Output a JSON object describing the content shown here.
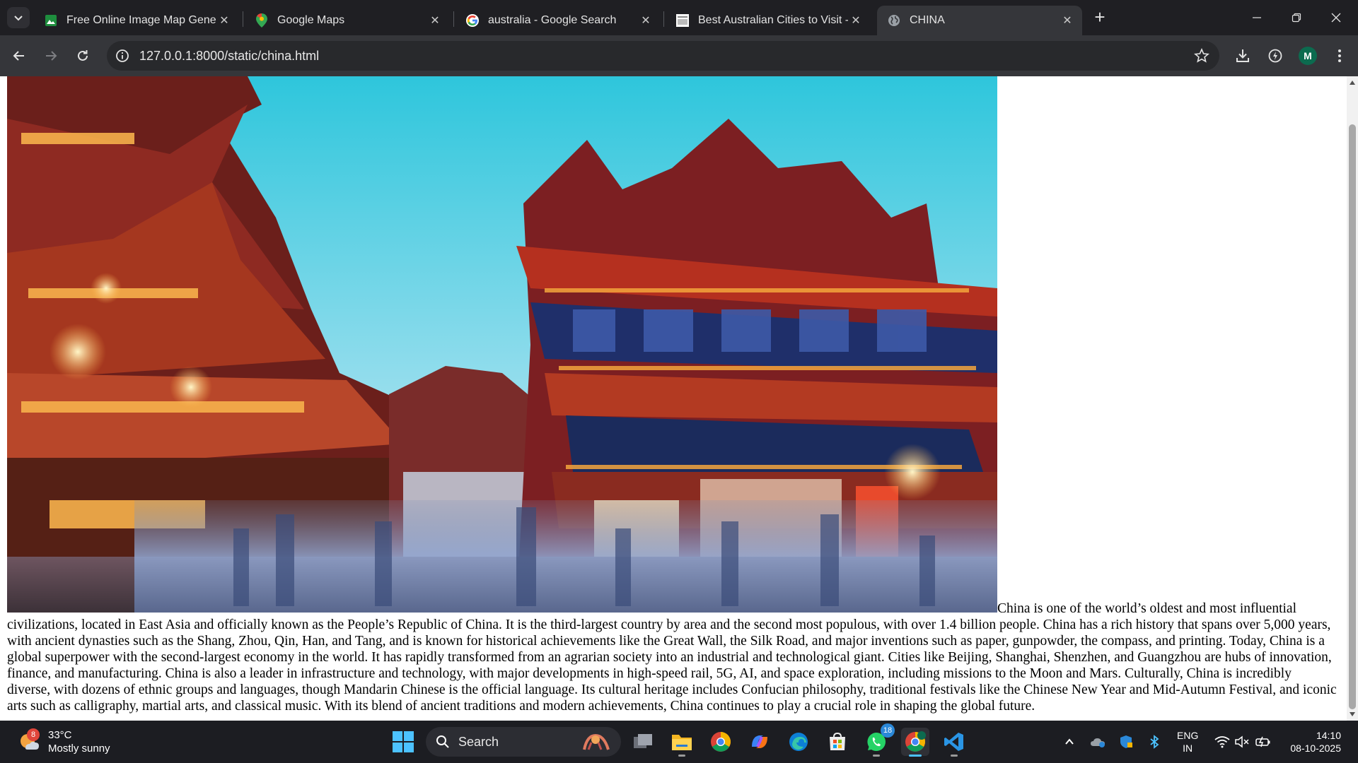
{
  "browser": {
    "tabs": [
      {
        "title": "Free Online Image Map Genera",
        "icon": "image-map-generator-favicon",
        "active": false
      },
      {
        "title": "Google Maps",
        "icon": "google-maps-favicon",
        "active": false
      },
      {
        "title": "australia - Google Search",
        "icon": "google-favicon",
        "active": false
      },
      {
        "title": "Best Australian Cities to Visit - E",
        "icon": "site-favicon",
        "active": false
      },
      {
        "title": "CHINA",
        "icon": "globe-favicon",
        "active": true
      }
    ],
    "close_glyph": "✕",
    "new_tab_glyph": "+",
    "url": "127.0.0.1:8000/static/china.html",
    "profile_initial": "M"
  },
  "page": {
    "image_alt": "",
    "paragraph": "China is one of the world’s oldest and most influential civilizations, located in East Asia and officially known as the People’s Republic of China. It is the third-largest country by area and the second most populous, with over 1.4 billion people. China has a rich history that spans over 5,000 years, with ancient dynasties such as the Shang, Zhou, Qin, Han, and Tang, and is known for historical achievements like the Great Wall, the Silk Road, and major inventions such as paper, gunpowder, the compass, and printing. Today, China is a global superpower with the second-largest economy in the world. It has rapidly transformed from an agrarian society into an industrial and technological giant. Cities like Beijing, Shanghai, Shenzhen, and Guangzhou are hubs of innovation, finance, and manufacturing. China is also a leader in infrastructure and technology, with major developments in high-speed rail, 5G, AI, and space exploration, including missions to the Moon and Mars. Culturally, China is incredibly diverse, with dozens of ethnic groups and languages, though Mandarin Chinese is the official language. Its cultural heritage includes Confucian philosophy, traditional festivals like the Chinese New Year and Mid-Autumn Festival, and iconic arts such as calligraphy, martial arts, and classical music. With its blend of ancient traditions and modern achievements, China continues to play a crucial role in shaping the global future."
  },
  "taskbar": {
    "weather_temp": "33°C",
    "weather_desc": "Mostly sunny",
    "weather_badge": "8",
    "search_label": "Search",
    "whatsapp_badge": "18",
    "lang_line1": "ENG",
    "lang_line2": "IN",
    "time": "14:10",
    "date": "08-10-2025"
  },
  "colors": {
    "tab_bar": "#1f1f23",
    "toolbar": "#35363a",
    "omnibox": "#28292c",
    "taskbar": "#1c1d22",
    "accent": "#4cc2ff"
  }
}
